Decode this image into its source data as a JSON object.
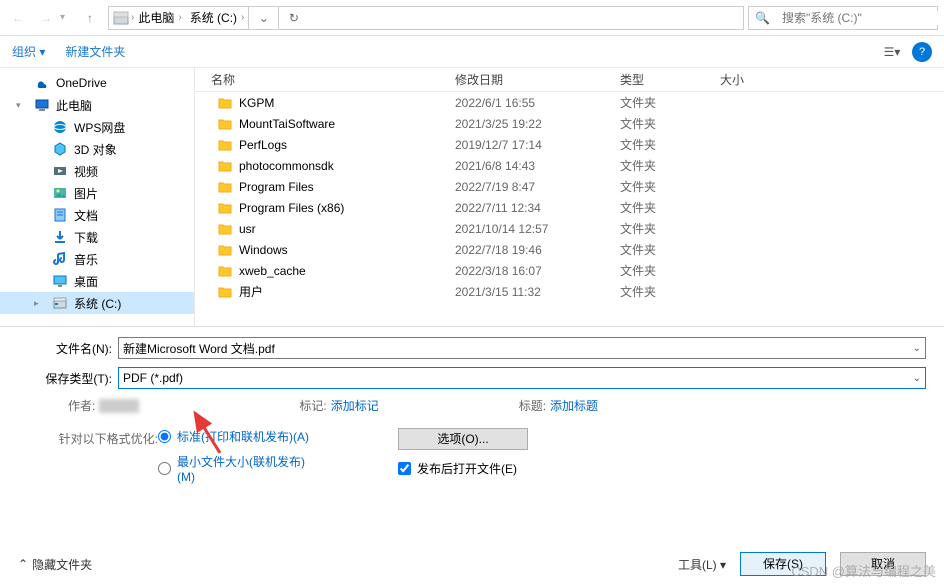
{
  "nav": {
    "breadcrumbs": [
      "此电脑",
      "系统 (C:)"
    ],
    "search_placeholder": "搜索\"系统 (C:)\""
  },
  "cmdbar": {
    "organize": "组织 ▾",
    "new_folder": "新建文件夹"
  },
  "sidebar": {
    "items": [
      {
        "icon": "onedrive",
        "label": "OneDrive",
        "level": 0,
        "exp": ""
      },
      {
        "icon": "pc",
        "label": "此电脑",
        "level": 0,
        "exp": "▾"
      },
      {
        "icon": "wps",
        "label": "WPS网盘",
        "level": 1
      },
      {
        "icon": "3d",
        "label": "3D 对象",
        "level": 1
      },
      {
        "icon": "video",
        "label": "视频",
        "level": 1
      },
      {
        "icon": "picture",
        "label": "图片",
        "level": 1
      },
      {
        "icon": "doc",
        "label": "文档",
        "level": 1
      },
      {
        "icon": "download",
        "label": "下载",
        "level": 1
      },
      {
        "icon": "music",
        "label": "音乐",
        "level": 1
      },
      {
        "icon": "desktop",
        "label": "桌面",
        "level": 1
      },
      {
        "icon": "drive",
        "label": "系统 (C:)",
        "level": 1,
        "sel": true,
        "exp": "▸"
      }
    ]
  },
  "columns": {
    "name": "名称",
    "date": "修改日期",
    "type": "类型",
    "size": "大小"
  },
  "files": [
    {
      "name": "KGPM",
      "date": "2022/6/1 16:55",
      "type": "文件夹"
    },
    {
      "name": "MountTaiSoftware",
      "date": "2021/3/25 19:22",
      "type": "文件夹"
    },
    {
      "name": "PerfLogs",
      "date": "2019/12/7 17:14",
      "type": "文件夹"
    },
    {
      "name": "photocommonsdk",
      "date": "2021/6/8 14:43",
      "type": "文件夹"
    },
    {
      "name": "Program Files",
      "date": "2022/7/19 8:47",
      "type": "文件夹"
    },
    {
      "name": "Program Files (x86)",
      "date": "2022/7/11 12:34",
      "type": "文件夹"
    },
    {
      "name": "usr",
      "date": "2021/10/14 12:57",
      "type": "文件夹"
    },
    {
      "name": "Windows",
      "date": "2022/7/18 19:46",
      "type": "文件夹"
    },
    {
      "name": "xweb_cache",
      "date": "2022/3/18 16:07",
      "type": "文件夹"
    },
    {
      "name": "用户",
      "date": "2021/3/15 11:32",
      "type": "文件夹"
    }
  ],
  "save": {
    "filename_label": "文件名(N):",
    "filename_value": "新建Microsoft Word 文档.pdf",
    "filetype_label": "保存类型(T):",
    "filetype_value": "PDF (*.pdf)",
    "author_label": "作者:",
    "tags_label": "标记:",
    "tags_link": "添加标记",
    "title_label": "标题:",
    "title_link": "添加标题",
    "optimize_label": "针对以下格式优化:",
    "radio1": "标准(打印和联机发布)(A)",
    "radio2": "最小文件大小(联机发布)(M)",
    "options_btn": "选项(O)...",
    "open_after": "发布后打开文件(E)",
    "hide_folders": "隐藏文件夹",
    "tools": "工具(L)",
    "save_btn": "保存(S)",
    "cancel_btn": "取消"
  },
  "watermark": "CSDN @算法与编程之美"
}
